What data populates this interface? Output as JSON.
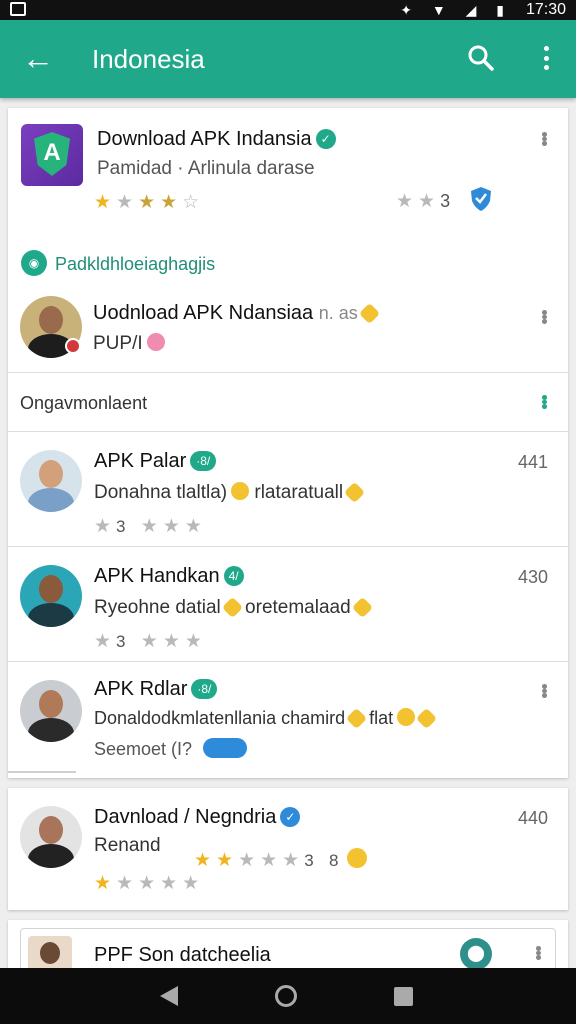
{
  "status_bar": {
    "time": "17:30",
    "icons": "✦ ▼ ◢ ▮"
  },
  "app_bar": {
    "title": "Indonesia",
    "back_icon": "back-arrow-icon",
    "search_icon": "search-icon",
    "menu_icon": "more-vert-icon"
  },
  "featured": {
    "name": "Download APK Indansia",
    "publisher": "Pamidad · Arlinula darase",
    "rating_count": "3",
    "verified": "✓"
  },
  "section_one": {
    "label": "Padkldhloeiaghagjis",
    "item": {
      "name": "Uodnload APK Ndansiaa",
      "suffix": "n. as",
      "sub": "PUP/I"
    }
  },
  "section_two": {
    "label": "Ongavmonlaent",
    "items": [
      {
        "name": "APK Palar",
        "badge": "·8/",
        "sub_a": "Donahna tlaltla)",
        "sub_b": "rlataratuall",
        "rating": "3",
        "count": "441"
      },
      {
        "name": "APK Handkan",
        "badge": "4/",
        "sub_a": "Ryeohne datial",
        "sub_b": "oretemalaad",
        "rating": "3",
        "count": "430"
      },
      {
        "name": "APK Rdlar",
        "badge": "·8/",
        "sub_a": "Donaldodkmlatenllania chamird",
        "sub_b": "flat",
        "meta": "Seemoet (I?",
        "count": ""
      }
    ]
  },
  "card_three": {
    "name": "Davnload / Negndria",
    "sub": "Renand",
    "rating": "3",
    "rating_b": "8",
    "count": "440"
  },
  "card_four": {
    "name": "PPF Son datcheelia"
  }
}
